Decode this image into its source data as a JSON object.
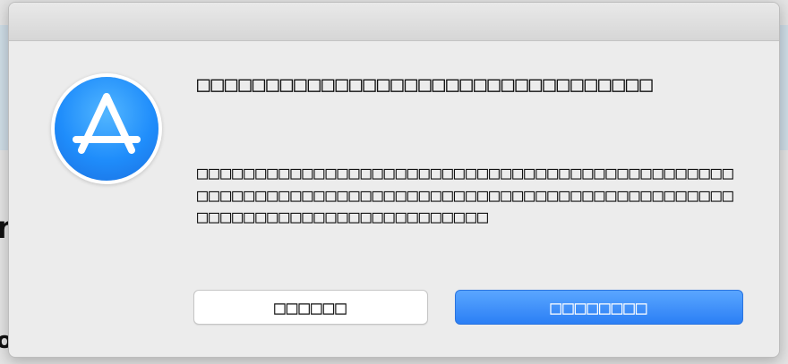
{
  "dialog": {
    "headline": "□□□□□□□□□□□□□□□□□□□□□□□□□□□□□□□□□",
    "message": "□□□□□□□□□□□□□□□□□□□□□□□□□□□□□□□□□□□□□□□□□□□□□□□□□□□□□□□□□□□□□□□□□□□□□□□□□□□□□□□□□□□□□□□□□□□□□□□□□□□□□□□□□□□□□□□□□□□□□",
    "cancel_label": "□□□□□□",
    "primary_label": "□□□□□□□□",
    "icon": "app-store-icon"
  },
  "backdrop": {
    "glyph_1": "n",
    "glyph_2": "o"
  },
  "colors": {
    "primary_button": "#2b7ff5",
    "icon_blue": "#1f8dfb",
    "dialog_bg": "#ececec"
  }
}
